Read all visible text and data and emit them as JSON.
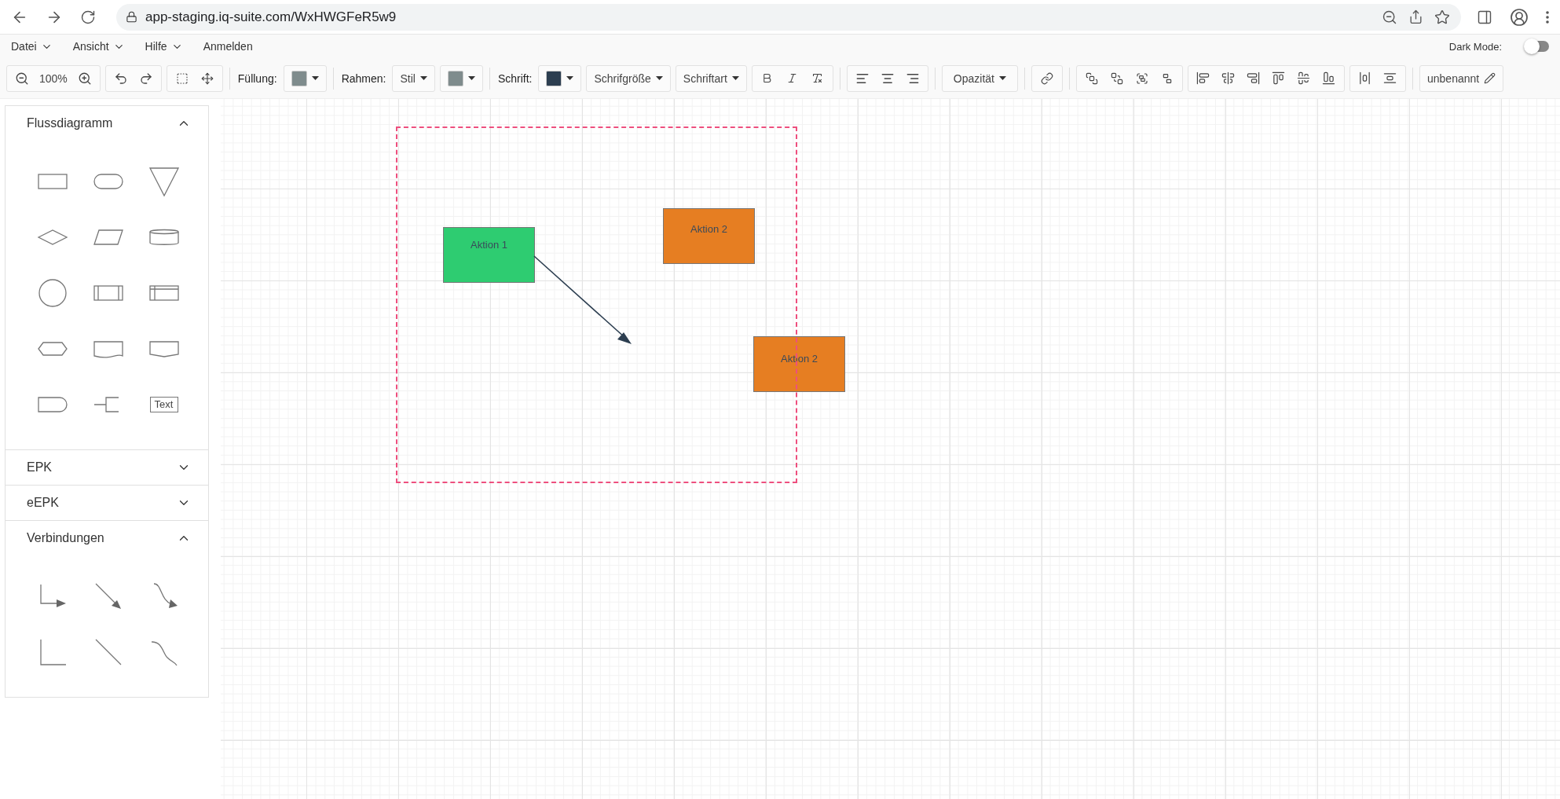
{
  "browser": {
    "url": "app-staging.iq-suite.com/WxHWGFeR5w9"
  },
  "menu": [
    {
      "label": "Datei",
      "kind": "dropdown"
    },
    {
      "label": "Ansicht",
      "kind": "dropdown"
    },
    {
      "label": "Hilfe",
      "kind": "dropdown"
    },
    {
      "label": "Anmelden",
      "kind": "link"
    }
  ],
  "dark_mode": {
    "label": "Dark Mode:",
    "on": false
  },
  "toolbar": {
    "zoom": "100%",
    "fill": {
      "label": "Füllung:",
      "color": "#7f8c8d"
    },
    "border": {
      "label": "Rahmen:",
      "style": "Stil",
      "color": "#7f8c8d"
    },
    "font": {
      "label": "Schrift:",
      "color": "#2c3e50",
      "size": "Schrifgröße",
      "family": "Schriftart"
    },
    "opacity": "Opazität",
    "document_name": "unbenannt"
  },
  "sidebar": {
    "sections": [
      {
        "title": "Flussdiagramm",
        "expanded": true,
        "items": [
          {
            "kind": "process"
          },
          {
            "kind": "terminator"
          },
          {
            "kind": "merge"
          },
          {
            "kind": "decision"
          },
          {
            "kind": "data"
          },
          {
            "kind": "database"
          },
          {
            "kind": "circle"
          },
          {
            "kind": "subprocess"
          },
          {
            "kind": "internal-storage"
          },
          {
            "kind": "preparation"
          },
          {
            "kind": "document"
          },
          {
            "kind": "offpage"
          },
          {
            "kind": "delay"
          },
          {
            "kind": "annotation"
          },
          {
            "kind": "text",
            "text": "Text"
          }
        ]
      },
      {
        "title": "EPK",
        "expanded": false
      },
      {
        "title": "eEPK",
        "expanded": false
      },
      {
        "title": "Verbindungen",
        "expanded": true,
        "items": [
          {
            "kind": "elbow-arrow"
          },
          {
            "kind": "straight-arrow"
          },
          {
            "kind": "curve-arrow"
          },
          {
            "kind": "elbow-line"
          },
          {
            "kind": "straight-line"
          },
          {
            "kind": "curve-line"
          }
        ]
      }
    ]
  },
  "canvas": {
    "selection": {
      "visible": true
    },
    "nodes": [
      {
        "label": "Aktion 1",
        "color": "#2ecc71"
      },
      {
        "label": "Aktion 2",
        "color": "#e67e22"
      },
      {
        "label": "Aktion 2",
        "color": "#e67e22"
      }
    ]
  }
}
